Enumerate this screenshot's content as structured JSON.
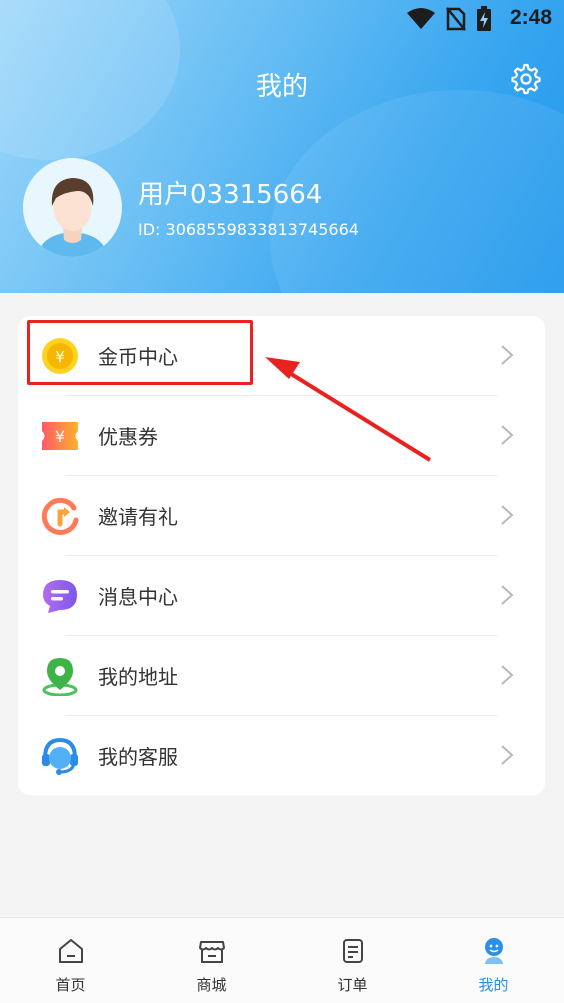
{
  "status_bar": {
    "time": "2:48"
  },
  "header": {
    "title": "我的",
    "username": "用户03315664",
    "user_id": "ID: 3068559833813745664"
  },
  "menu": {
    "items": [
      {
        "label": "金币中心",
        "icon": "coin-icon"
      },
      {
        "label": "优惠券",
        "icon": "coupon-icon"
      },
      {
        "label": "邀请有礼",
        "icon": "invite-icon"
      },
      {
        "label": "消息中心",
        "icon": "message-icon"
      },
      {
        "label": "我的地址",
        "icon": "location-pin-icon"
      },
      {
        "label": "我的客服",
        "icon": "customer-service-icon"
      }
    ]
  },
  "tabbar": {
    "tabs": [
      {
        "label": "首页",
        "icon": "home-icon"
      },
      {
        "label": "商城",
        "icon": "store-icon"
      },
      {
        "label": "订单",
        "icon": "order-icon"
      },
      {
        "label": "我的",
        "icon": "profile-icon",
        "active": true
      }
    ]
  },
  "colors": {
    "accent": "#2b8fe8",
    "highlight_box": "#e8231f",
    "header_gradient_start": "#9fd8fb",
    "header_gradient_end": "#1f97ec"
  }
}
